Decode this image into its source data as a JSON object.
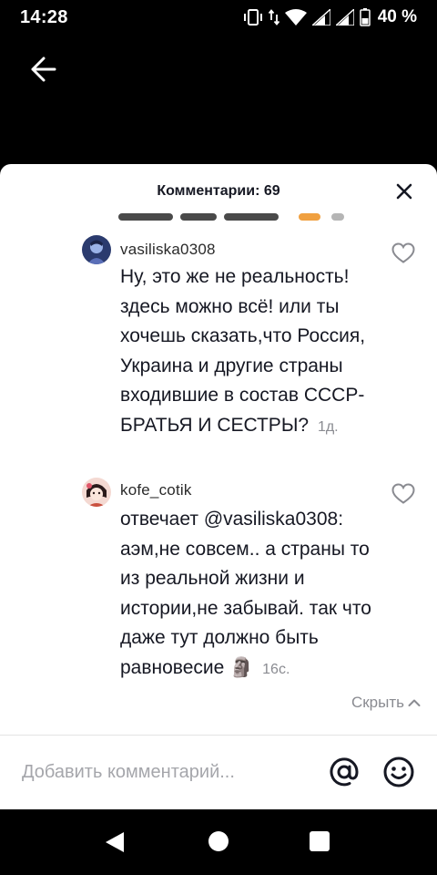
{
  "status_bar": {
    "time": "14:28",
    "battery": "40 %",
    "icons": [
      "vibrate-icon",
      "data-arrows-icon",
      "wifi-icon",
      "signal-icon",
      "signal-icon",
      "battery-icon"
    ]
  },
  "sheet": {
    "title": "Комментарии: 69"
  },
  "comments": [
    {
      "username": "vasiliska0308",
      "text": "Ну, это же не реальность! здесь можно всё! или ты хочешь сказать,что Россия, Украина и другие страны входившие в состав СССР- БРАТЬЯ И СЕСТРЫ?",
      "time": "1д."
    },
    {
      "username": "kofe_cotik",
      "reply_prefix": "отвечает",
      "mention": "@vasiliska0308",
      "text": ": аэм,не совсем.. а страны то из реальной жизни и истории,не забывай. так что даже тут должно быть равновесие",
      "emoji": "🗿",
      "time": "16с."
    }
  ],
  "hide_replies_label": "Скрыть",
  "input": {
    "placeholder": "Добавить комментарий..."
  },
  "colors": {
    "background": "#000000",
    "sheet": "#ffffff",
    "text_primary": "#161823",
    "text_secondary": "#8a8b91"
  }
}
